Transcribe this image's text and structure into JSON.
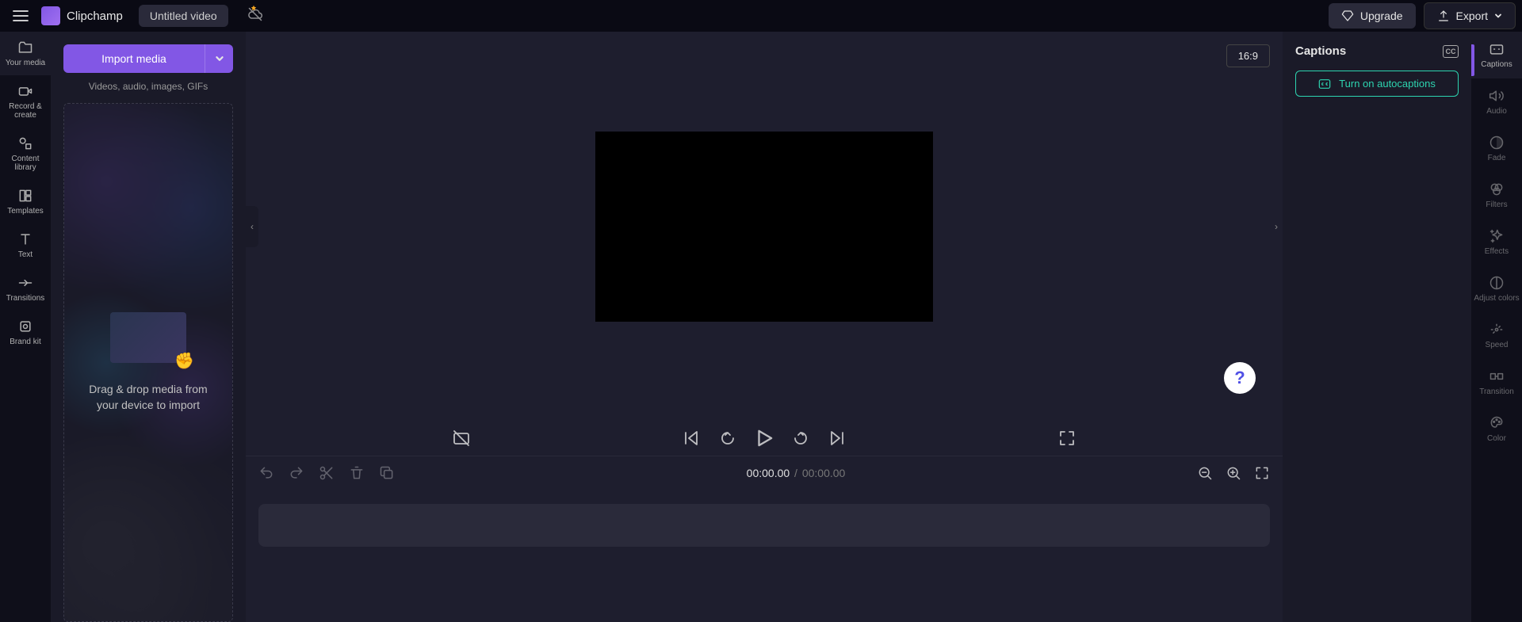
{
  "header": {
    "app_name": "Clipchamp",
    "title": "Untitled video",
    "upgrade_label": "Upgrade",
    "export_label": "Export"
  },
  "left_rail": {
    "items": [
      {
        "label": "Your media",
        "icon": "folder"
      },
      {
        "label": "Record & create",
        "icon": "camera"
      },
      {
        "label": "Content library",
        "icon": "shapes"
      },
      {
        "label": "Templates",
        "icon": "templates"
      },
      {
        "label": "Text",
        "icon": "text"
      },
      {
        "label": "Transitions",
        "icon": "transitions"
      },
      {
        "label": "Brand kit",
        "icon": "brand"
      }
    ]
  },
  "media_panel": {
    "import_label": "Import media",
    "hint": "Videos, audio, images, GIFs",
    "dropzone_text": "Drag & drop media from your device to import"
  },
  "stage": {
    "aspect_label": "16:9",
    "help_label": "?"
  },
  "timeline": {
    "current": "00:00.00",
    "separator": "/",
    "total": "00:00.00"
  },
  "captions_panel": {
    "title": "Captions",
    "cc_badge": "CC",
    "button_label": "Turn on autocaptions"
  },
  "prop_rail": {
    "items": [
      {
        "label": "Captions",
        "icon": "cc"
      },
      {
        "label": "Audio",
        "icon": "audio"
      },
      {
        "label": "Fade",
        "icon": "fade"
      },
      {
        "label": "Filters",
        "icon": "filters"
      },
      {
        "label": "Effects",
        "icon": "effects"
      },
      {
        "label": "Adjust colors",
        "icon": "adjust"
      },
      {
        "label": "Speed",
        "icon": "speed"
      },
      {
        "label": "Transition",
        "icon": "transition"
      },
      {
        "label": "Color",
        "icon": "color"
      }
    ]
  }
}
